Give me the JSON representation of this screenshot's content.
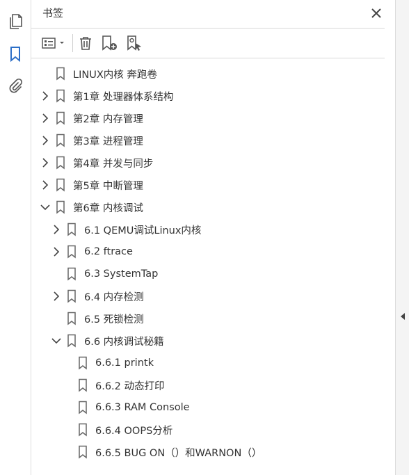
{
  "panel": {
    "title": "书签"
  },
  "toolbar": {
    "options": "options-menu",
    "delete": "delete-bookmark",
    "new": "new-bookmark",
    "new_from_structure": "new-bookmark-from-structure"
  },
  "bookmarks": [
    {
      "label": "LINUX内核 奔跑卷",
      "level": 0,
      "chevron": "none"
    },
    {
      "label": "第1章 处理器体系结构",
      "level": 0,
      "chevron": "right"
    },
    {
      "label": "第2章 内存管理",
      "level": 0,
      "chevron": "right"
    },
    {
      "label": "第3章 进程管理",
      "level": 0,
      "chevron": "right"
    },
    {
      "label": "第4章 并发与同步",
      "level": 0,
      "chevron": "right"
    },
    {
      "label": "第5章 中断管理",
      "level": 0,
      "chevron": "right"
    },
    {
      "label": "第6章 内核调试",
      "level": 0,
      "chevron": "down"
    },
    {
      "label": "6.1 QEMU调试Linux内核",
      "level": 1,
      "chevron": "right"
    },
    {
      "label": "6.2 ftrace",
      "level": 1,
      "chevron": "right"
    },
    {
      "label": "6.3 SystemTap",
      "level": 1,
      "chevron": "none"
    },
    {
      "label": "6.4 内存检测",
      "level": 1,
      "chevron": "right"
    },
    {
      "label": "6.5 死锁检测",
      "level": 1,
      "chevron": "none"
    },
    {
      "label": "6.6 内核调试秘籍",
      "level": 1,
      "chevron": "down"
    },
    {
      "label": "6.6.1 printk",
      "level": 2,
      "chevron": "none"
    },
    {
      "label": "6.6.2 动态打印",
      "level": 2,
      "chevron": "none"
    },
    {
      "label": "6.6.3 RAM Console",
      "level": 2,
      "chevron": "none"
    },
    {
      "label": "6.6.4 OOPS分析",
      "level": 2,
      "chevron": "none"
    },
    {
      "label": "6.6.5 BUG ON（）和WARNON（）",
      "level": 2,
      "chevron": "none"
    }
  ],
  "colors": {
    "active": "#2d6fc7",
    "icon": "#555555"
  }
}
